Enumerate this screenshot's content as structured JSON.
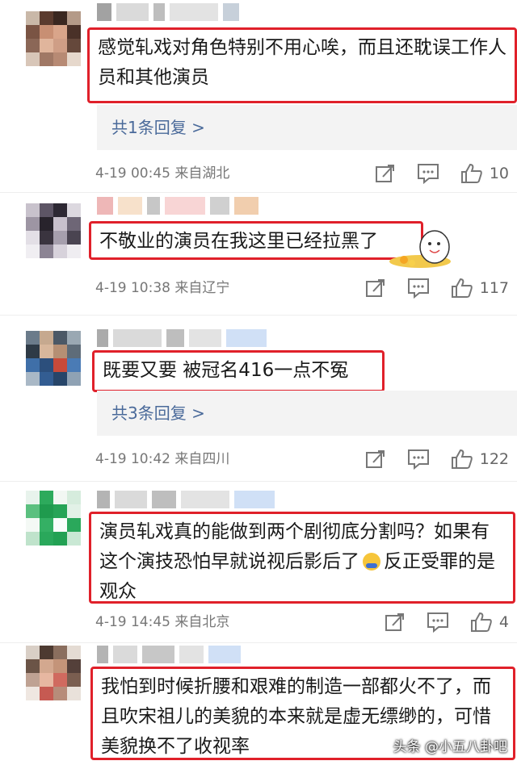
{
  "comments": [
    {
      "text": "感觉轧戏对角色特别不用心唉，而且还耽误工作人员和其他演员",
      "reply_label": "共1条回复 >",
      "time": "4-19 00:45",
      "location": "来自湖北",
      "likes": "10"
    },
    {
      "text": "不敬业的演员在我这里已经拉黑了",
      "time": "4-19 10:38",
      "location": "来自辽宁",
      "likes": "117"
    },
    {
      "text": "既要又要 被冠名416一点不冤",
      "reply_label": "共3条回复 >",
      "time": "4-19 10:42",
      "location": "来自四川",
      "likes": "122"
    },
    {
      "text_part1": "演员轧戏真的能做到两个剧彻底分割吗？如果有这个演技恐怕早就说视后影后了",
      "text_part2": "反正受罪的是观众",
      "time": "4-19 14:45",
      "location": "来自北京",
      "likes": "4"
    },
    {
      "text": "我怕到时候折腰和艰难的制造一部都火不了，而且吹宋祖儿的美貌的本来就是虚无缥缈的，可惜美貌换不了收视率"
    }
  ],
  "icons": {
    "repost": "repost-icon",
    "comment": "comment-icon",
    "like": "thumbs-up-icon",
    "emoji": "emoji-icon"
  },
  "watermark": "头条 @小五八卦吧",
  "colors": {
    "highlight_border": "#e0202a",
    "reply_link": "#4a6a9a",
    "meta_text": "#777777"
  }
}
